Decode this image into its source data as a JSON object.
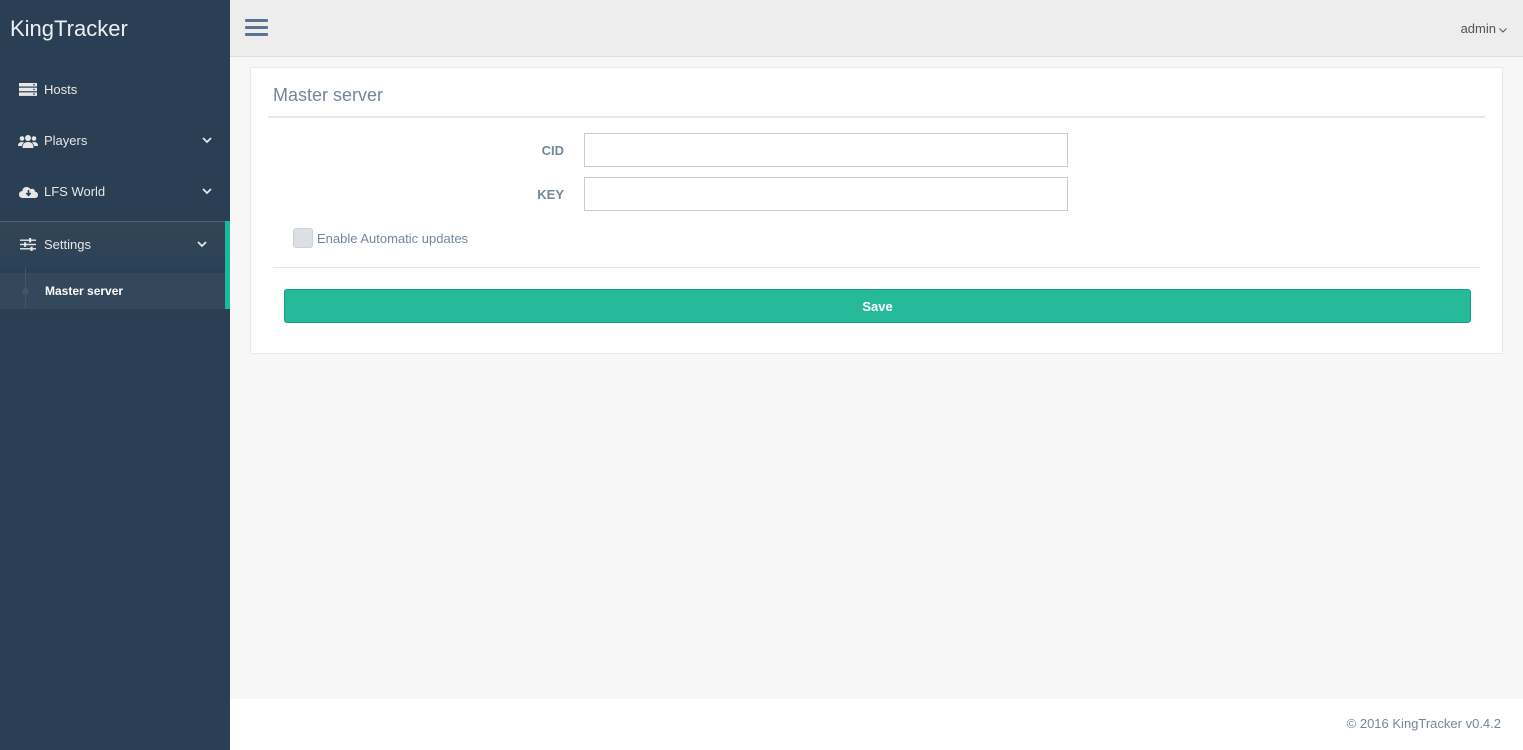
{
  "app": {
    "title": "KingTracker"
  },
  "sidebar": {
    "items": [
      {
        "label": "Hosts",
        "icon": "server-icon"
      },
      {
        "label": "Players",
        "icon": "users-icon"
      },
      {
        "label": "LFS World",
        "icon": "cloud-download-icon"
      },
      {
        "label": "Settings",
        "icon": "sliders-icon"
      }
    ],
    "submenu": [
      {
        "label": "Master server"
      }
    ]
  },
  "topnav": {
    "user": "admin"
  },
  "panel": {
    "title": "Master server",
    "fields": [
      {
        "label": "CID",
        "value": "",
        "placeholder": ""
      },
      {
        "label": "KEY",
        "value": "",
        "placeholder": ""
      }
    ],
    "checkbox_label": "Enable Automatic updates",
    "save_label": "Save"
  },
  "footer": {
    "text": "© 2016 KingTracker v0.4.2"
  },
  "colors": {
    "sidebar": "#2a3f54",
    "accent": "#1abb9c",
    "button": "#26b99a"
  }
}
